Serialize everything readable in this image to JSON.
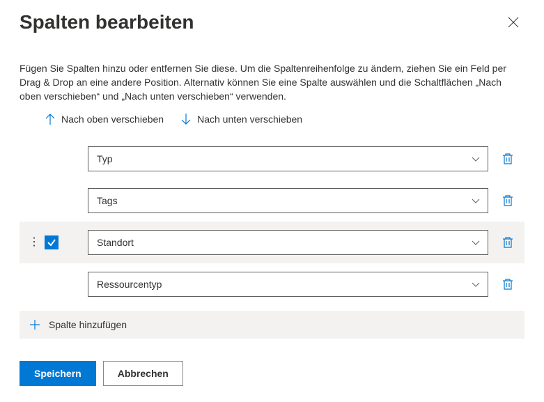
{
  "header": {
    "title": "Spalten bearbeiten"
  },
  "description": "Fügen Sie Spalten hinzu oder entfernen Sie diese. Um die Spaltenreihenfolge zu ändern, ziehen Sie ein Feld per Drag & Drop an eine andere Position. Alternativ können Sie eine Spalte auswählen und die Schaltflächen „Nach oben verschieben“ und „Nach unten verschieben“ verwenden.",
  "actions": {
    "move_up": "Nach oben verschieben",
    "move_down": "Nach unten verschieben",
    "add_column": "Spalte hinzufügen"
  },
  "columns": [
    {
      "label": "Typ",
      "selected": false
    },
    {
      "label": "Tags",
      "selected": false
    },
    {
      "label": "Standort",
      "selected": true
    },
    {
      "label": "Ressourcentyp",
      "selected": false
    }
  ],
  "footer": {
    "save": "Speichern",
    "cancel": "Abbrechen"
  }
}
